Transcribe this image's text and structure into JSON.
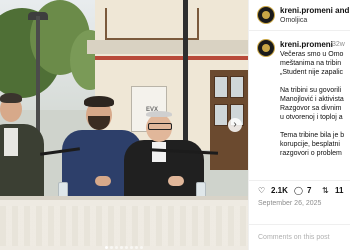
{
  "post": {
    "username": "kreni.promeni",
    "header_extra": "and",
    "location": "Omoljica",
    "caption_time": "32w",
    "caption_lines": [
      "Večeras smo u Omo",
      "meštanima na tribin",
      "„Student nije zapalic",
      "",
      "Na tribini su govorili",
      "Manojlović i aktivista",
      "Razgovor sa divnim",
      "u otvorenoj i toploj a",
      "",
      "Tema tribine bila je b",
      "korupcije, besplatni",
      "razgovori o problem"
    ],
    "likes": "2.1K",
    "comments_count": "7",
    "shares": "11",
    "date": "September 26, 2025",
    "comments_hint": "Comments on this post"
  },
  "carousel": {
    "next_icon": "chevron-right-icon",
    "dots_total": 8,
    "active_dot": 0,
    "poster_text": "EVX"
  },
  "colors": {
    "avatar_gold": "#c9a646",
    "text_primary": "#111111",
    "text_muted": "#8e8e8e"
  }
}
